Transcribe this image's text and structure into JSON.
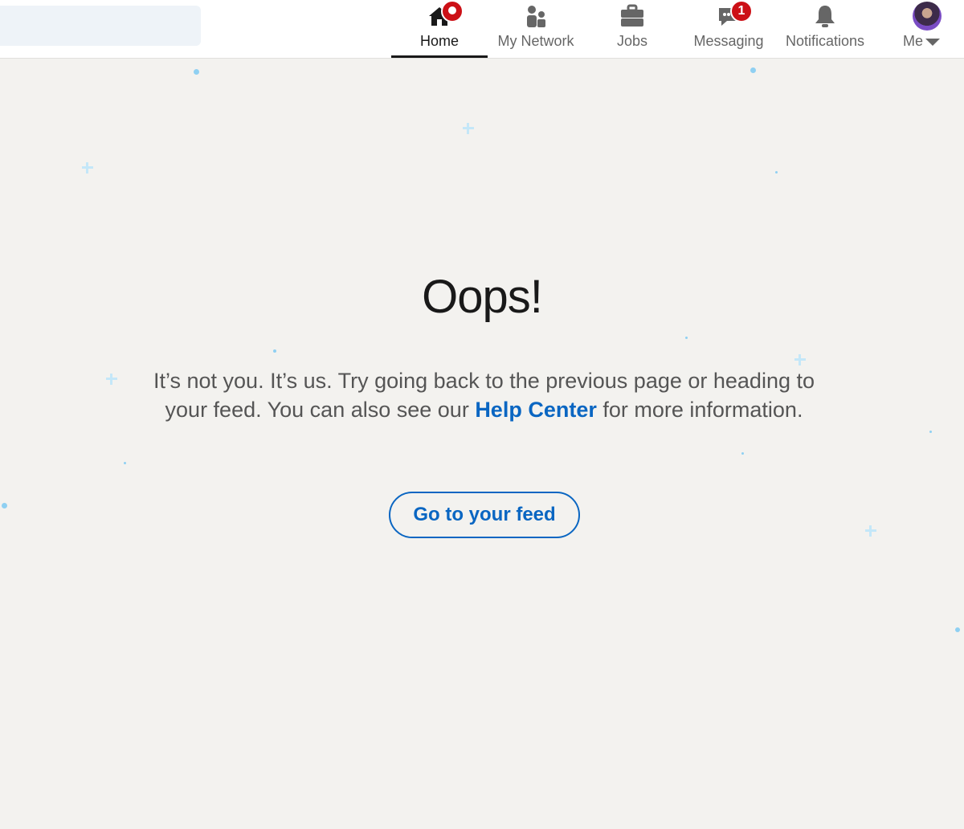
{
  "nav": {
    "items": [
      {
        "id": "home",
        "label": "Home",
        "icon": "home-icon",
        "active": true,
        "badge": ""
      },
      {
        "id": "network",
        "label": "My Network",
        "icon": "people-icon",
        "active": false,
        "badge": ""
      },
      {
        "id": "jobs",
        "label": "Jobs",
        "icon": "briefcase-icon",
        "active": false,
        "badge": ""
      },
      {
        "id": "messaging",
        "label": "Messaging",
        "icon": "chat-icon",
        "active": false,
        "badge": "1"
      },
      {
        "id": "notifications",
        "label": "Notifications",
        "icon": "bell-icon",
        "active": false,
        "badge": ""
      },
      {
        "id": "me",
        "label": "Me",
        "icon": "avatar",
        "active": false,
        "badge": ""
      }
    ]
  },
  "error": {
    "title": "Oops!",
    "message_before": "It’s not you. It’s us. Try going back to the previous page or heading to your feed. You can also see our ",
    "help_link": "Help Center",
    "message_after": " for more information.",
    "button_label": "Go to your feed"
  },
  "colors": {
    "accent": "#0a66c2",
    "badge": "#cc1016",
    "background": "#f3f2ef",
    "sparkle": "#8fd0f2"
  }
}
